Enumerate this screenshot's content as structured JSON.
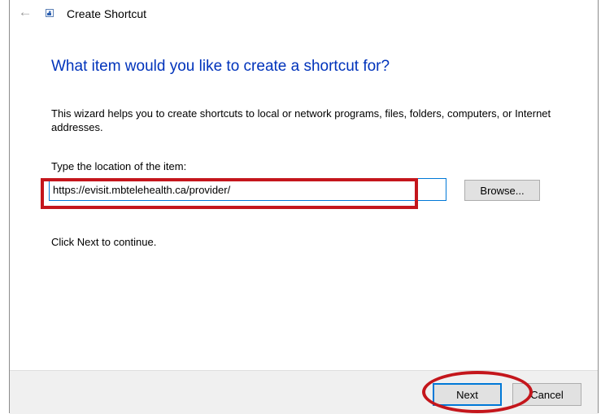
{
  "window": {
    "title": "Create Shortcut"
  },
  "wizard": {
    "heading": "What item would you like to create a shortcut for?",
    "description": "This wizard helps you to create shortcuts to local or network programs, files, folders, computers, or Internet addresses.",
    "location_label": "Type the location of the item:",
    "location_value": "https://evisit.mbtelehealth.ca/provider/",
    "browse_label": "Browse...",
    "continue_text": "Click Next to continue."
  },
  "footer": {
    "next_label": "Next",
    "cancel_label": "Cancel"
  },
  "annotations": {
    "highlight_color": "#c4161c"
  },
  "icons": {
    "back": "back-arrow-icon",
    "app": "shortcut-icon"
  },
  "colors": {
    "heading": "#0033bb",
    "focus": "#0078d7"
  }
}
